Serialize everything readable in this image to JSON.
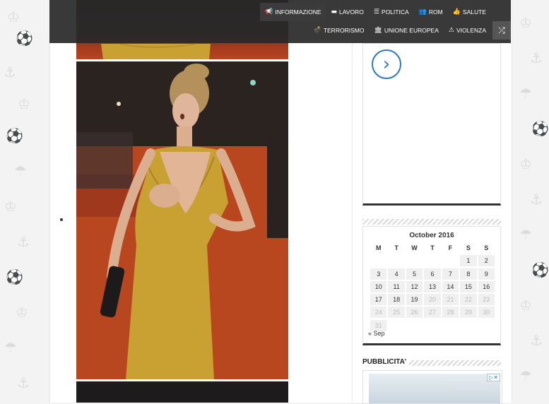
{
  "nav": {
    "row1": [
      {
        "icon": "bullhorn-icon",
        "glyph": "📢",
        "label": "INFORMAZIONE",
        "active": true
      },
      {
        "icon": "briefcase-icon",
        "glyph": "▬",
        "label": "LAVORO",
        "active": false
      },
      {
        "icon": "list-icon",
        "glyph": "☰",
        "label": "POLITICA",
        "active": false
      },
      {
        "icon": "users-icon",
        "glyph": "👥",
        "label": "ROM",
        "active": false
      },
      {
        "icon": "thumbs-up-icon",
        "glyph": "👍",
        "label": "SALUTE",
        "active": false
      }
    ],
    "row2": [
      {
        "icon": "bomb-icon",
        "glyph": "💣",
        "label": "TERRORISMO",
        "active": false
      },
      {
        "icon": "institution-icon",
        "glyph": "🏛",
        "label": "UNIONE EUROPEA",
        "active": false
      },
      {
        "icon": "warning-icon",
        "glyph": "⚠",
        "label": "VIOLENZA",
        "active": false
      }
    ],
    "shuffle_glyph": "⤮"
  },
  "sidebar": {
    "next_glyph": "›",
    "calendar": {
      "caption": "October 2016",
      "weekdays": [
        "M",
        "T",
        "W",
        "T",
        "F",
        "S",
        "S"
      ],
      "weeks": [
        [
          "",
          "",
          "",
          "",
          "",
          "1",
          "2"
        ],
        [
          "3",
          "4",
          "5",
          "6",
          "7",
          "8",
          "9"
        ],
        [
          "10",
          "11",
          "12",
          "13",
          "14",
          "15",
          "16"
        ],
        [
          "17",
          "18",
          "19",
          "20",
          "21",
          "22",
          "23"
        ],
        [
          "24",
          "25",
          "26",
          "27",
          "28",
          "29",
          "30"
        ],
        [
          "31",
          "",
          "",
          "",
          "",
          "",
          ""
        ]
      ],
      "last_past_day": 19,
      "prev_link": "« Sep"
    },
    "ad_section_title": "PUBBLICITA'"
  },
  "colors": {
    "nav_bg": "#282828",
    "accent_blue": "#2c78c6",
    "dress": "#c9a032",
    "carpet": "#b2431f"
  }
}
